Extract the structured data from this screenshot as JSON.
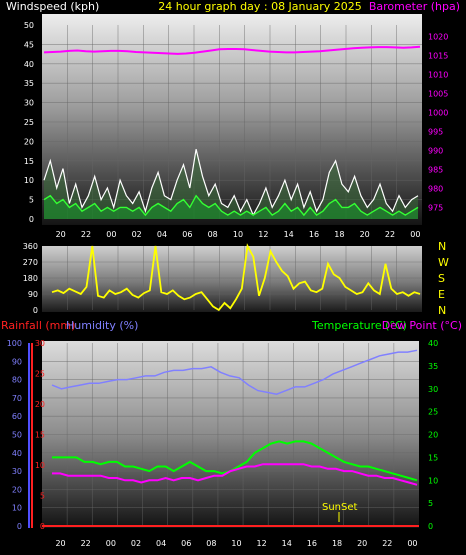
{
  "header": {
    "windspeed_label": "Windspeed (kph)",
    "title": "24 hour graph day : 08 January 2025",
    "barometer_label": "Barometer (hpa)"
  },
  "panel2": {
    "direction_labels": [
      "N",
      "W",
      "S",
      "E",
      "N"
    ]
  },
  "panel3": {
    "rainfall_label": "Rainfall (mm)",
    "humidity_label": "Humidity (%)",
    "temperature_label": "Temperature (°C)",
    "dewpoint_label": "Dew Point (°C)",
    "sunset_label": "SunSet"
  },
  "colors": {
    "windspeed": "#ffffff",
    "barometer": "#ff00ff",
    "gust_fill": "#1e8a2e",
    "avg_wind": "#33ff33",
    "direction": "#ffff00",
    "rainfall": "#ff2020",
    "humidity": "#8080ff",
    "temperature": "#00ff00",
    "dewpoint": "#ff00ff"
  },
  "chart_data": [
    {
      "type": "line",
      "x_ticks": [
        "20",
        "22",
        "00",
        "02",
        "04",
        "06",
        "08",
        "10",
        "12",
        "14",
        "16",
        "18",
        "20",
        "22",
        "00"
      ],
      "left_axis": {
        "label": "Windspeed (kph)",
        "ylim": [
          0,
          50
        ],
        "ticks": [
          0,
          5,
          10,
          15,
          20,
          25,
          30,
          35,
          40,
          45,
          50
        ]
      },
      "right_axis": {
        "label": "Barometer (hpa)",
        "ylim": [
          972,
          1023
        ],
        "ticks": [
          975,
          980,
          985,
          990,
          995,
          1000,
          1005,
          1010,
          1015,
          1020
        ]
      },
      "series": [
        {
          "axis": "left",
          "values": [
            10,
            15,
            8,
            13,
            4,
            9,
            3,
            6,
            11,
            5,
            8,
            3,
            10,
            6,
            4,
            7,
            2,
            8,
            12,
            6,
            5,
            10,
            14,
            8,
            18,
            11,
            6,
            9,
            4,
            3,
            6,
            2,
            5,
            1,
            4,
            8,
            3,
            6,
            10,
            5,
            9,
            3,
            7,
            2,
            5,
            12,
            15,
            9,
            7,
            11,
            6,
            3,
            5,
            9,
            4,
            2,
            6,
            3,
            5,
            6
          ]
        },
        {
          "axis": "left",
          "values": [
            5,
            6,
            4,
            5,
            3,
            4,
            2,
            3,
            4,
            2,
            3,
            2,
            3,
            3,
            2,
            3,
            1,
            3,
            4,
            3,
            2,
            4,
            5,
            3,
            6,
            4,
            3,
            4,
            2,
            1,
            2,
            1,
            2,
            1,
            2,
            3,
            1,
            2,
            4,
            2,
            3,
            1,
            3,
            1,
            2,
            4,
            5,
            3,
            3,
            4,
            2,
            1,
            2,
            3,
            2,
            1,
            2,
            1,
            2,
            3
          ]
        },
        {
          "axis": "right",
          "values": [
            1015.8,
            1015.9,
            1016.0,
            1016.2,
            1016.3,
            1016.1,
            1016.0,
            1016.1,
            1016.2,
            1016.2,
            1016.1,
            1015.9,
            1015.8,
            1015.7,
            1015.6,
            1015.5,
            1015.4,
            1015.5,
            1015.7,
            1016.0,
            1016.3,
            1016.6,
            1016.7,
            1016.7,
            1016.6,
            1016.4,
            1016.2,
            1016.0,
            1015.9,
            1015.8,
            1015.8,
            1015.9,
            1016.0,
            1016.1,
            1016.3,
            1016.5,
            1016.7,
            1016.9,
            1017.0,
            1017.1,
            1017.2,
            1017.2,
            1017.1,
            1017.0,
            1017.1,
            1017.3
          ]
        }
      ]
    },
    {
      "type": "line",
      "x_ticks": [
        "20",
        "22",
        "00",
        "02",
        "04",
        "06",
        "08",
        "10",
        "12",
        "14",
        "16",
        "18",
        "20",
        "22",
        "00"
      ],
      "ylim": [
        0,
        360
      ],
      "ticks": [
        0,
        90,
        180,
        270,
        360
      ],
      "series": [
        {
          "values": [
            100,
            110,
            95,
            120,
            105,
            90,
            130,
            360,
            80,
            70,
            110,
            90,
            100,
            120,
            85,
            70,
            95,
            110,
            360,
            100,
            90,
            110,
            80,
            60,
            70,
            90,
            100,
            60,
            20,
            0,
            40,
            10,
            60,
            120,
            360,
            300,
            80,
            180,
            330,
            270,
            220,
            190,
            120,
            150,
            160,
            110,
            100,
            120,
            260,
            200,
            180,
            130,
            110,
            90,
            100,
            150,
            110,
            90,
            260,
            120,
            90,
            100,
            80,
            100,
            90
          ]
        }
      ]
    },
    {
      "type": "line",
      "x_ticks": [
        "20",
        "22",
        "00",
        "02",
        "04",
        "06",
        "08",
        "10",
        "12",
        "14",
        "16",
        "18",
        "20",
        "22",
        "00"
      ],
      "rainfall_axis": {
        "label": "Rainfall (mm)",
        "ylim": [
          0,
          30
        ],
        "ticks": [
          0,
          5,
          10,
          15,
          20,
          25,
          30
        ]
      },
      "humidity_axis": {
        "label": "Humidity (%)",
        "ylim": [
          0,
          100
        ],
        "ticks": [
          0,
          10,
          20,
          30,
          40,
          50,
          60,
          70,
          80,
          90,
          100
        ]
      },
      "temperature_axis": {
        "label": "Temperature (°C)",
        "ylim": [
          0,
          40
        ],
        "ticks": [
          0,
          5,
          10,
          15,
          20,
          25,
          30,
          35,
          40
        ]
      },
      "series": [
        {
          "axis": "rainfall",
          "values": [
            0,
            0,
            0,
            0,
            0,
            0,
            0,
            0,
            0,
            0,
            0,
            0,
            0,
            0,
            0,
            0,
            0,
            0,
            0,
            0,
            0,
            0,
            0,
            0
          ]
        },
        {
          "axis": "humidity",
          "values": [
            77,
            75,
            76,
            77,
            78,
            78,
            79,
            80,
            80,
            81,
            82,
            82,
            84,
            85,
            85,
            86,
            86,
            87,
            84,
            82,
            81,
            77,
            74,
            73,
            72,
            74,
            76,
            76,
            78,
            80,
            83,
            85,
            87,
            89,
            91,
            93,
            94,
            95,
            95,
            96
          ]
        },
        {
          "axis": "temperature",
          "values": [
            15,
            15,
            15,
            15,
            14,
            14,
            13.5,
            14,
            14,
            13,
            13,
            12.5,
            12,
            13,
            13,
            12,
            13,
            14,
            13,
            12,
            12,
            11.5,
            12,
            13,
            14,
            16,
            17,
            18,
            18.5,
            18,
            18.5,
            18.5,
            18,
            17,
            16,
            15,
            14,
            13.5,
            13,
            13,
            12.5,
            12,
            11.5,
            11,
            10.5,
            10
          ]
        },
        {
          "axis": "temperature",
          "values": [
            11.5,
            11.5,
            11,
            11,
            11,
            11,
            11,
            10.5,
            10.5,
            10,
            10,
            9.5,
            10,
            10,
            10.5,
            10,
            10.5,
            10.5,
            10,
            10.5,
            11,
            11,
            12,
            12.5,
            13,
            13,
            13.5,
            13.5,
            13.5,
            13.5,
            13.5,
            13.5,
            13,
            13,
            12.5,
            12.5,
            12,
            12,
            11.5,
            11,
            11,
            10.5,
            10.5,
            10,
            9.5,
            9
          ]
        }
      ]
    }
  ]
}
